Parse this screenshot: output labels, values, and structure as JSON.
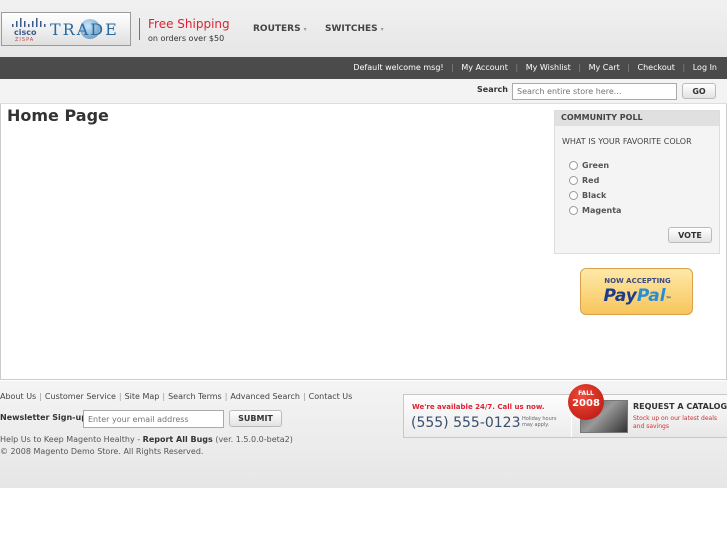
{
  "header": {
    "logo": {
      "cisco": "cisco",
      "zispa": "ZISPA",
      "trade": "TRADE"
    },
    "shipping": {
      "title": "Free Shipping",
      "subtitle": "on orders over $50"
    },
    "nav": [
      {
        "label": "ROUTERS"
      },
      {
        "label": "SWITCHES"
      }
    ],
    "nav_caret": "▾"
  },
  "topbar": {
    "welcome": "Default welcome msg!",
    "links": [
      {
        "label": "My Account"
      },
      {
        "label": "My Wishlist"
      },
      {
        "label": "My Cart"
      },
      {
        "label": "Checkout"
      },
      {
        "label": "Log In"
      }
    ],
    "separator": "|"
  },
  "search": {
    "label": "Search",
    "placeholder": "Search entire store here...",
    "button": "GO"
  },
  "main": {
    "title": "Home Page"
  },
  "poll": {
    "title": "COMMUNITY POLL",
    "question": "WHAT IS YOUR FAVORITE COLOR",
    "options": [
      {
        "label": "Green"
      },
      {
        "label": "Red"
      },
      {
        "label": "Black"
      },
      {
        "label": "Magenta"
      }
    ],
    "vote_button": "VOTE"
  },
  "paypal": {
    "now": "NOW ACCEPTING",
    "pay": "Pay",
    "pal": "Pal",
    "tm": "™"
  },
  "footer": {
    "links": [
      {
        "label": "About Us"
      },
      {
        "label": "Customer Service"
      },
      {
        "label": "Site Map"
      },
      {
        "label": "Search Terms"
      },
      {
        "label": "Advanced Search"
      },
      {
        "label": "Contact Us"
      }
    ],
    "separator": "|",
    "newsletter": {
      "label": "Newsletter Sign-up:",
      "placeholder": "Enter your email address",
      "button": "SUBMIT"
    },
    "help_prefix": "Help Us to Keep Magento Healthy - ",
    "help_link": "Report All Bugs",
    "help_version": " (ver. 1.5.0.0-beta2)",
    "copyright": "© 2008 Magento Demo Store. All Rights Reserved."
  },
  "banner": {
    "available": "We're available 24/7. Call us now.",
    "phone": "(555) 555-0123",
    "holiday": "Holiday hours may apply.",
    "fall_word": "FALL",
    "fall_year": "2008",
    "request": "REQUEST A CATALOG!",
    "stock": "Stock up on our latest deals and savings"
  },
  "colors": {
    "topbar": "#4b4b4b",
    "accent_red": "#d22233",
    "link_gray": "#444444"
  }
}
